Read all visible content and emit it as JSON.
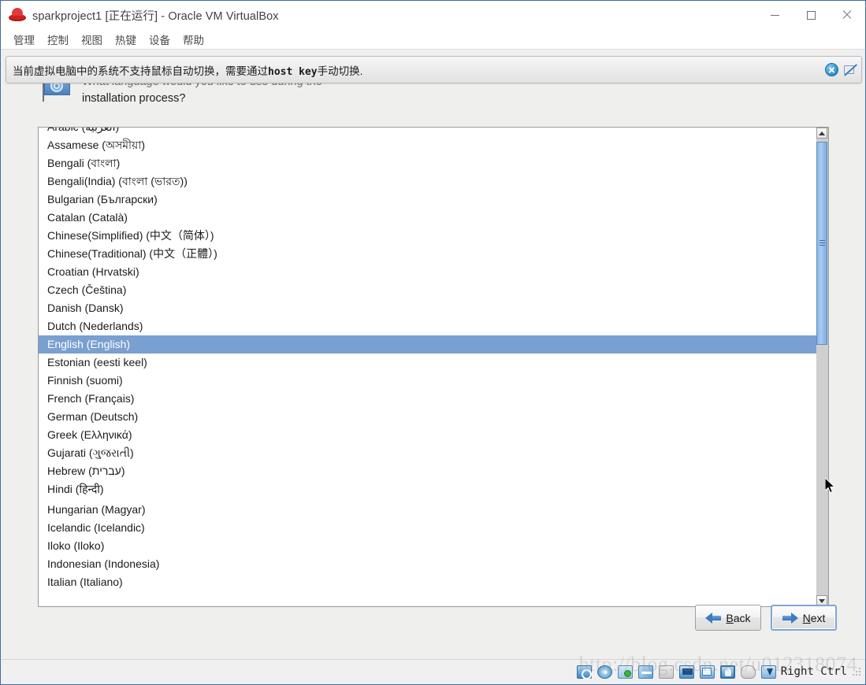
{
  "window": {
    "title": "sparkproject1 [正在运行] - Oracle VM VirtualBox",
    "app_icon": "redhat-icon",
    "controls": {
      "minimize": "minimize-button",
      "maximize": "maximize-button",
      "close": "close-button"
    }
  },
  "menu": {
    "items": [
      {
        "label": "管理"
      },
      {
        "label": "控制"
      },
      {
        "label": "视图"
      },
      {
        "label": "热键"
      },
      {
        "label": "设备"
      },
      {
        "label": "帮助"
      }
    ]
  },
  "notification": {
    "text_before": "当前虚拟电脑中的系统不支持鼠标自动切换，需要通过",
    "text_mono": "host key",
    "text_after": "手动切换.",
    "close_icon": "close-circle-icon",
    "mouse_icon": "mouse-integration-disabled-icon"
  },
  "installer": {
    "flag_icon": "language-flag-icon",
    "prompt_line_1": "What language would you like to use during the",
    "prompt_line_2": "installation process?",
    "languages": [
      {
        "label": "Arabic (العربية)",
        "selected": false
      },
      {
        "label": "Assamese (অসমীয়া)",
        "selected": false
      },
      {
        "label": "Bengali (বাংলা)",
        "selected": false
      },
      {
        "label": "Bengali(India) (বাংলা (ভারত))",
        "selected": false
      },
      {
        "label": "Bulgarian (Български)",
        "selected": false
      },
      {
        "label": "Catalan (Català)",
        "selected": false
      },
      {
        "label": "Chinese(Simplified) (中文（简体）)",
        "selected": false
      },
      {
        "label": "Chinese(Traditional) (中文（正體）)",
        "selected": false
      },
      {
        "label": "Croatian (Hrvatski)",
        "selected": false
      },
      {
        "label": "Czech (Čeština)",
        "selected": false
      },
      {
        "label": "Danish (Dansk)",
        "selected": false
      },
      {
        "label": "Dutch (Nederlands)",
        "selected": false
      },
      {
        "label": "English (English)",
        "selected": true
      },
      {
        "label": "Estonian (eesti keel)",
        "selected": false
      },
      {
        "label": "Finnish (suomi)",
        "selected": false
      },
      {
        "label": "French (Français)",
        "selected": false
      },
      {
        "label": "German (Deutsch)",
        "selected": false
      },
      {
        "label": "Greek (Ελληνικά)",
        "selected": false
      },
      {
        "label": "Gujarati (ગુજરાતી)",
        "selected": false
      },
      {
        "label": "Hebrew (עברית)",
        "selected": false
      },
      {
        "label": "Hindi (हिन्दी)",
        "selected": false
      },
      {
        "label": "Hungarian (Magyar)",
        "selected": false
      },
      {
        "label": "Icelandic (Icelandic)",
        "selected": false
      },
      {
        "label": "Iloko (Iloko)",
        "selected": false
      },
      {
        "label": "Indonesian (Indonesia)",
        "selected": false
      },
      {
        "label": "Italian (Italiano)",
        "selected": false
      }
    ],
    "selected_language": "English (English)",
    "scrollbar": {
      "up_arrow": "scroll-up-icon",
      "down_arrow": "scroll-down-icon"
    },
    "buttons": {
      "back": {
        "label": "Back",
        "mnemonic": "B",
        "rest": "ack",
        "icon": "arrow-left-icon",
        "focused": false
      },
      "next": {
        "label": "Next",
        "mnemonic": "N",
        "rest": "ext",
        "icon": "arrow-right-icon",
        "focused": true
      }
    }
  },
  "status_bar": {
    "devices": [
      {
        "name": "hard-disk-icon"
      },
      {
        "name": "optical-disk-icon"
      },
      {
        "name": "network-icon"
      },
      {
        "name": "usb-icon"
      },
      {
        "name": "shared-folder-icon"
      },
      {
        "name": "display-icon"
      },
      {
        "name": "remote-screen-icon"
      },
      {
        "name": "cpu-icon"
      },
      {
        "name": "mouse-icon"
      },
      {
        "name": "host-key-icon"
      }
    ],
    "host_key_label": "Right Ctrl"
  },
  "watermark": {
    "text": "http://blog.csdn.net/u012318074"
  },
  "colors": {
    "selection_blue": "#7a9fd1",
    "scrollbar_thumb": "#8cb4e4",
    "accent_border": "#3b6ea5",
    "vm_background": "#efefee"
  }
}
